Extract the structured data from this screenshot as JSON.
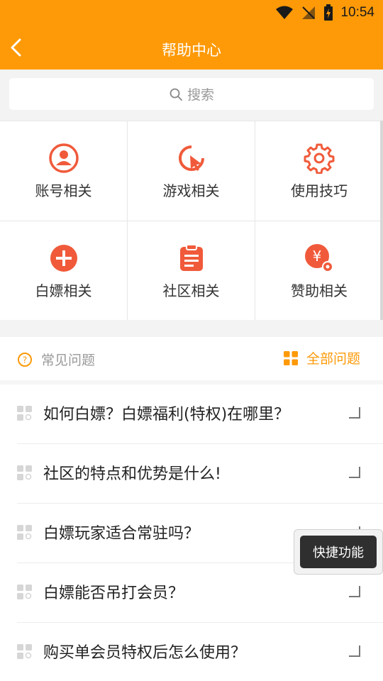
{
  "status_bar": {
    "time": "10:54"
  },
  "header": {
    "title": "帮助中心"
  },
  "search": {
    "placeholder": "搜索"
  },
  "categories": [
    {
      "label": "账号相关",
      "icon": "user-circle-icon"
    },
    {
      "label": "游戏相关",
      "icon": "game-cursor-icon"
    },
    {
      "label": "使用技巧",
      "icon": "gear-icon"
    },
    {
      "label": "白嫖相关",
      "icon": "plus-circle-icon"
    },
    {
      "label": "社区相关",
      "icon": "clipboard-icon"
    },
    {
      "label": "赞助相关",
      "icon": "yen-settings-icon"
    }
  ],
  "faq": {
    "title": "常见问题",
    "all_label": "全部问题",
    "items": [
      "如何白嫖？白嫖福利(特权)在哪里？",
      "社区的特点和优势是什么!",
      "白嫖玩家适合常驻吗？",
      "白嫖能否吊打会员？",
      "购买单会员特权后怎么使用？"
    ]
  },
  "shortcut": {
    "label": "快捷功能"
  },
  "colors": {
    "accent": "#fe9a08",
    "icon_red": "#f05a3a"
  }
}
